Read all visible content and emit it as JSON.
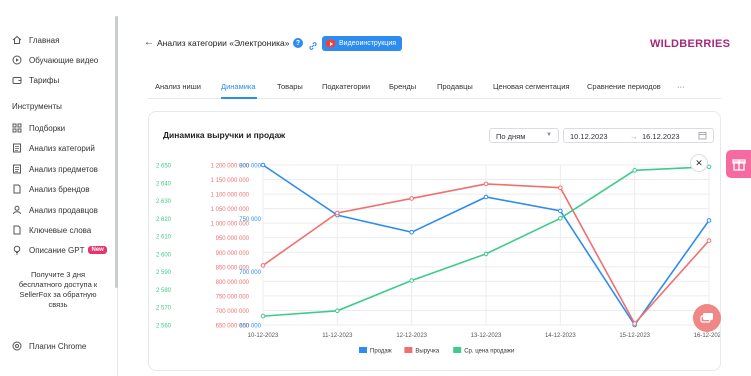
{
  "sidebar": {
    "items": [
      {
        "label": "Главная",
        "icon": "home-icon"
      },
      {
        "label": "Обучающие видео",
        "icon": "video-icon"
      },
      {
        "label": "Тарифы",
        "icon": "wallet-icon"
      }
    ],
    "section_title": "Инструменты",
    "tools": [
      {
        "label": "Подборки",
        "icon": "grid-icon"
      },
      {
        "label": "Анализ категорий",
        "icon": "list-icon"
      },
      {
        "label": "Анализ предметов",
        "icon": "list-icon"
      },
      {
        "label": "Анализ брендов",
        "icon": "doc-icon"
      },
      {
        "label": "Анализ продавцов",
        "icon": "user-icon"
      },
      {
        "label": "Ключевые слова",
        "icon": "doc-icon"
      },
      {
        "label": "Описание GPT",
        "icon": "bulb-icon",
        "badge": "New"
      }
    ],
    "promo_text": "Получите 3 дня бесплатного доступа к SellerFox за обратную связь",
    "chrome_plugin": "Плагин Chrome"
  },
  "header": {
    "title": "Анализ категории «Электроника»",
    "video_button": "Видеоинструкция",
    "brand": "WILDBERRIES"
  },
  "tabs": [
    "Анализ ниши",
    "Динамика",
    "Товары",
    "Подкатегории",
    "Бренды",
    "Продавцы",
    "Ценовая сегментация",
    "Сравнение периодов",
    "···"
  ],
  "active_tab": "Динамика",
  "card": {
    "title": "Динамика выручки и продаж",
    "period_select": "По дням",
    "date_from": "10.12.2023",
    "date_sep": "→",
    "date_to": "16.12.2023"
  },
  "chart_data": {
    "type": "line",
    "title": "Динамика выручки и продаж",
    "x": [
      "10-12-2023",
      "11-12-2023",
      "12-12-2023",
      "13-12-2023",
      "14-12-2023",
      "15-12-2023",
      "16-12-2023"
    ],
    "axes": [
      {
        "side": "left-outer",
        "color": "#3ecb8b",
        "ylim": [
          2600,
          2650
        ],
        "ticks": [
          "2 650",
          "2 640",
          "2 630",
          "2 620",
          "2 610",
          "2 600",
          "2 590",
          "2 580",
          "2 570",
          "2 560"
        ],
        "tick_values": [
          2650,
          2640,
          2630,
          2620,
          2610,
          2600,
          2590,
          2580,
          2570,
          2560
        ]
      },
      {
        "side": "left-middle",
        "color": "#f07070",
        "ticks": [
          "1 200 000 000",
          "1 150 000 000",
          "1 100 000 000",
          "1 050 000 000",
          "1 000 000 000",
          "950 000 000",
          "900 000 000",
          "850 000 000",
          "800 000 000",
          "750 000 000",
          "700 000 000",
          "650 000 000"
        ],
        "tick_values": [
          1200000000,
          1150000000,
          1100000000,
          1050000000,
          1000000000,
          950000000,
          900000000,
          850000000,
          800000000,
          750000000,
          700000000,
          650000000
        ]
      },
      {
        "side": "left-inner",
        "color": "#2d8cf0",
        "ticks": [
          "800 000",
          "750 000",
          "700 000",
          "650 000"
        ],
        "tick_values": [
          800000,
          750000,
          700000,
          650000
        ]
      }
    ],
    "series": [
      {
        "name": "Продаж",
        "color": "#2d8cf0",
        "axis": 2,
        "values": [
          800000,
          753000,
          737000,
          770000,
          757000,
          650000,
          748000
        ]
      },
      {
        "name": "Выручка",
        "color": "#f07070",
        "axis": 1,
        "values": [
          855000000,
          1035000000,
          1085000000,
          1135000000,
          1122000000,
          655000000,
          940000000
        ]
      },
      {
        "name": "Ср. цена продажи",
        "color": "#3ecb8b",
        "axis": 0,
        "values": [
          2565,
          2568,
          2585,
          2600,
          2620,
          2647,
          2649
        ]
      }
    ],
    "legend_position": "bottom",
    "grid": true
  }
}
